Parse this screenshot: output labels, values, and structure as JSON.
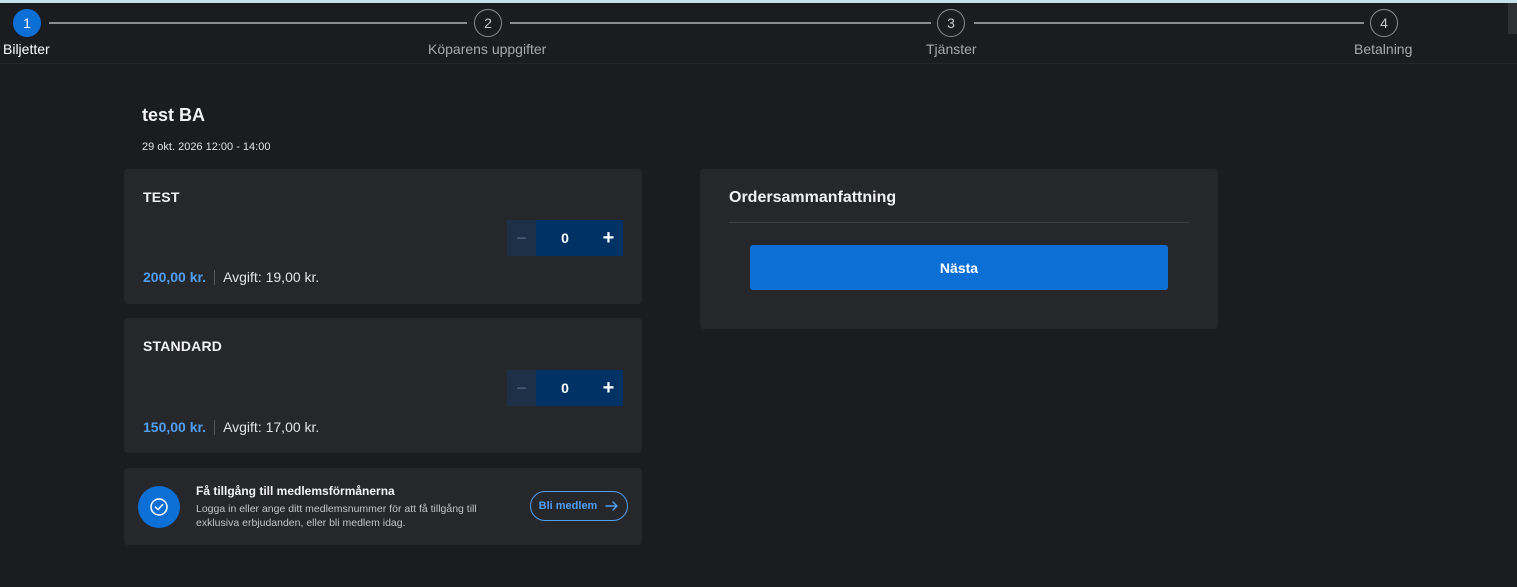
{
  "stepper": {
    "steps": [
      {
        "number": "1",
        "label": "Biljetter"
      },
      {
        "number": "2",
        "label": "Köparens uppgifter"
      },
      {
        "number": "3",
        "label": "Tjänster"
      },
      {
        "number": "4",
        "label": "Betalning"
      }
    ],
    "active_step": 1
  },
  "event": {
    "title": "test BA",
    "date": "29 okt. 2026 12:00 - 14:00"
  },
  "tickets": [
    {
      "name": "TEST",
      "quantity": "0",
      "price": "200,00 kr.",
      "fee": "Avgift: 19,00 kr."
    },
    {
      "name": "STANDARD",
      "quantity": "0",
      "price": "150,00 kr.",
      "fee": "Avgift: 17,00 kr."
    }
  ],
  "quantity_controls": {
    "minus_glyph": "−",
    "plus_glyph": "+"
  },
  "membership": {
    "title": "Få tillgång till medlemsförmånerna",
    "text": "Logga in eller ange ditt medlemsnummer för att få tillgång till exklusiva erbjudanden, eller bli medlem idag.",
    "button_label": "Bli medlem"
  },
  "summary": {
    "title": "Ordersammanfattning",
    "next_label": "Nästa"
  },
  "colors": {
    "accent": "#0b6fd6",
    "price": "#4f9ef2",
    "background": "#1b1c1f",
    "card": "#26272b"
  }
}
